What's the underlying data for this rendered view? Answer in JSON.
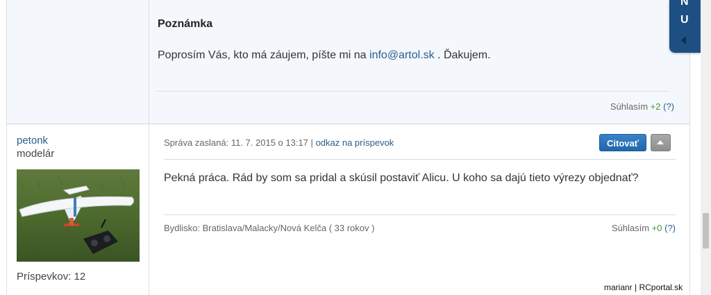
{
  "note": {
    "heading": "Poznámka",
    "text_before": "Poprosím Vás, kto má záujem, píšte mi na",
    "email": "info@artol.sk",
    "text_after": ". Ďakujem."
  },
  "top_agree": {
    "label": "Súhlasím",
    "count": "+2",
    "help": "(?)"
  },
  "side_tab": {
    "line1": "N",
    "line2": "U"
  },
  "post": {
    "username": "petonk",
    "user_title": "modelár",
    "post_count": "Príspevkov: 12",
    "meta_date": "Správa zaslaná: 11. 7. 2015 o 13:17",
    "meta_sep": "|",
    "permalink": "odkaz na príspevok",
    "quote_label": "Citovať",
    "text": "Pekná práca. Rád by som sa pridal a skúsil postaviť Alicu. U koho sa dajú tieto výrezy objednať?",
    "location": "Bydlisko: Bratislava/Malacky/Nová Kelča ( 33 rokov )",
    "agree": {
      "label": "Súhlasím",
      "count": "+0",
      "help": "(?)"
    }
  },
  "watermark": "marianr | RCportal.sk",
  "colors": {
    "link": "#2a5d8e",
    "accent_tab": "#1d4f82",
    "quote_button": "#2a72b8",
    "positive": "#3a9a3a"
  }
}
